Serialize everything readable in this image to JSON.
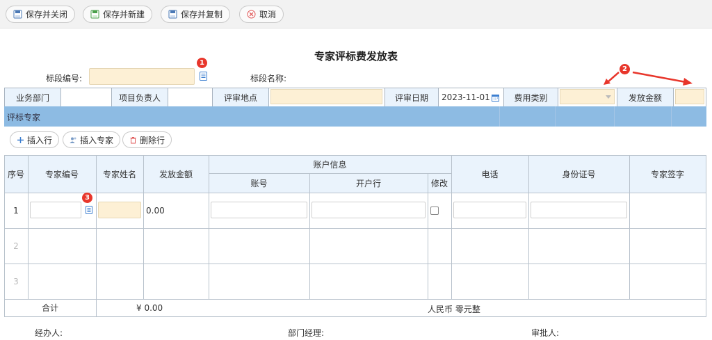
{
  "toolbar": {
    "save_close": "保存并关闭",
    "save_new": "保存并新建",
    "save_copy": "保存并复制",
    "cancel": "取消"
  },
  "title": "专家评标费发放表",
  "section_no_label": "标段编号:",
  "section_name_label": "标段名称:",
  "info_row": {
    "dept_label": "业务部门",
    "owner_label": "项目负责人",
    "location_label": "评审地点",
    "date_label": "评审日期",
    "date_value": "2023-11-01",
    "fee_type_label": "费用类别",
    "amount_label": "发放金额"
  },
  "band_label": "评标专家",
  "actions": {
    "insert_row": "插入行",
    "insert_expert": "插入专家",
    "delete_row": "删除行"
  },
  "table": {
    "headers": {
      "seq": "序号",
      "expert_no": "专家编号",
      "expert_name": "专家姓名",
      "amount": "发放金额",
      "account_info": "账户信息",
      "account": "账号",
      "bank": "开户行",
      "modify": "修改",
      "phone": "电话",
      "id_no": "身份证号",
      "signature": "专家签字"
    },
    "rows": [
      {
        "seq": "1",
        "amount": "0.00"
      },
      {
        "seq": "2"
      },
      {
        "seq": "3"
      }
    ],
    "total_label": "合计",
    "total_amount": "¥ 0.00",
    "total_rmb": "人民币 零元整"
  },
  "footer": {
    "handler": "经办人:",
    "manager": "部门经理:",
    "approver": "审批人:"
  },
  "badges": [
    "1",
    "2",
    "3"
  ],
  "colors": {
    "accent_blue": "#8dbbe3",
    "header_bg": "#eaf3fc",
    "input_yellow": "#fdf0d5",
    "badge_red": "#e8362b"
  }
}
